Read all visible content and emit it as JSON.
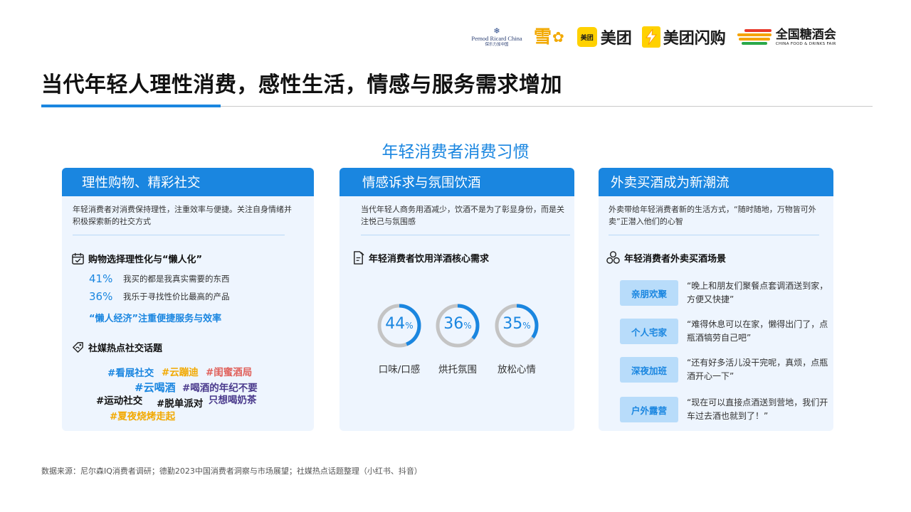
{
  "logos": {
    "pernod_en": "Pernod Ricard China",
    "pernod_cn": "保乐力加中国",
    "snow": "雪",
    "meituan_badge": "美团",
    "meituan": "美团",
    "shangou": "美团闪购",
    "fair_cn": "全国糖酒会",
    "fair_en": "CHINA FOOD & DRINKS FAIR"
  },
  "title": "当代年轻人理性消费，感性生活，情感与服务需求增加",
  "section_title": "年轻消费者消费习惯",
  "card1": {
    "header": "理性购物、精彩社交",
    "desc": "年轻消费者对消费保持理性，注重效率与便捷。关注自身情绪并积极探索新的社交方式",
    "sub1": "购物选择理性化与“懒人化”",
    "stats": [
      {
        "pct": "41%",
        "text": "我买的都是我真实需要的东西"
      },
      {
        "pct": "36%",
        "text": "我乐于寻找性价比最高的产品"
      }
    ],
    "lazy": "“懒人经济”注重便捷服务与效率",
    "sub2": "社媒热点社交话题",
    "tags": {
      "t1": "#看展社交",
      "t2": "#云蹦迪",
      "t3": "#闺蜜酒局",
      "t4": "#云喝酒",
      "t5": "#喝酒的年纪不要",
      "t6": "#运动社交",
      "t7": "#脱单派对",
      "t8": "只想喝奶茶",
      "t9": "#夏夜烧烤走起"
    }
  },
  "card2": {
    "header": "情感诉求与氛围饮酒",
    "desc": "当代年轻人商务用酒减少，饮酒不是为了彰显身份，而是关注悦己与氛围感",
    "sub": "年轻消费者饮用洋酒核心需求",
    "rings": [
      {
        "num": "44",
        "unit": "%",
        "label": "口味/口感",
        "value": 44
      },
      {
        "num": "36",
        "unit": "%",
        "label": "烘托氛围",
        "value": 36
      },
      {
        "num": "35",
        "unit": "%",
        "label": "放松心情",
        "value": 35
      }
    ]
  },
  "card3": {
    "header": "外卖买酒成为新潮流",
    "desc": "外卖带给年轻消费者新的生活方式，“随时随地，万物皆可外卖”正潜入他们的心智",
    "sub": "年轻消费者外卖买酒场景",
    "scenes": [
      {
        "badge": "亲朋欢聚",
        "quote": "“晚上和朋友们聚餐点套调酒送到家，方便又快捷”"
      },
      {
        "badge": "个人宅家",
        "quote": "“难得休息可以在家，懒得出门了，点瓶酒犒劳自己吧”"
      },
      {
        "badge": "深夜加班",
        "quote": "“还有好多活儿没干完呢，真烦，点瓶酒开心一下”"
      },
      {
        "badge": "户外露营",
        "quote": "“现在可以直接点酒送到营地，我们开车过去酒也就到了！”"
      }
    ]
  },
  "source": "数据来源：尼尔森IQ消费者调研；德勤2023中国消费者洞察与市场展望；社媒热点话题整理（小红书、抖音）",
  "colors": {
    "accent": "#1a86e0",
    "card_bg": "#eef5fe",
    "badge_bg": "#b8dcfa",
    "tag_blue": "#1a86e0",
    "tag_orange": "#f2a900",
    "tag_red": "#e0605a",
    "tag_purple": "#4a3a8c",
    "tag_black": "#111111",
    "ring_track": "#c4c4c4"
  }
}
